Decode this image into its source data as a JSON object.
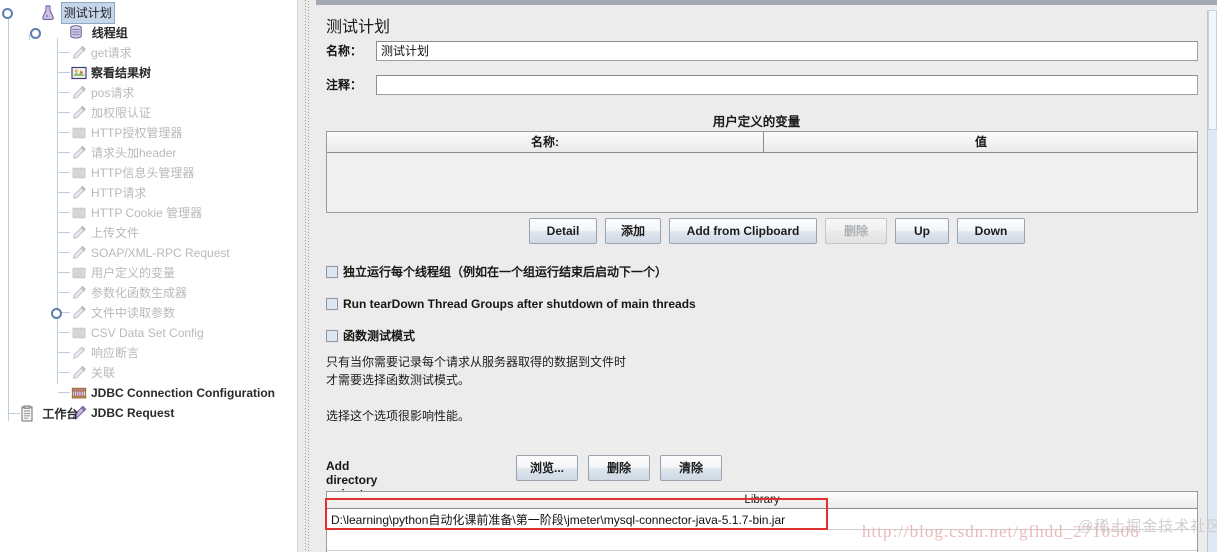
{
  "tree": {
    "root": {
      "label": "测试计划",
      "icon": "flask-icon",
      "selected": true
    },
    "threadgroup": {
      "label": "线程组",
      "icon": "thread-group-icon"
    },
    "items": [
      {
        "label": "get请求",
        "icon": "sampler-pencil-icon",
        "state": "dim"
      },
      {
        "label": "察看结果树",
        "icon": "view-results-tree-icon",
        "state": "solid"
      },
      {
        "label": "pos请求",
        "icon": "sampler-pencil-icon",
        "state": "dim"
      },
      {
        "label": "加权限认证",
        "icon": "sampler-pencil-icon",
        "state": "dim"
      },
      {
        "label": "HTTP授权管理器",
        "icon": "config-gear-icon",
        "state": "dim"
      },
      {
        "label": "请求头加header",
        "icon": "sampler-pencil-icon",
        "state": "dim"
      },
      {
        "label": "HTTP信息头管理器",
        "icon": "config-gear-icon",
        "state": "dim"
      },
      {
        "label": "HTTP请求",
        "icon": "sampler-pencil-icon",
        "state": "dim"
      },
      {
        "label": "HTTP Cookie 管理器",
        "icon": "config-gear-icon",
        "state": "dim"
      },
      {
        "label": "上传文件",
        "icon": "sampler-pencil-icon",
        "state": "dim"
      },
      {
        "label": "SOAP/XML-RPC Request",
        "icon": "sampler-pencil-icon",
        "state": "dim"
      },
      {
        "label": "用户定义的变量",
        "icon": "config-gear-icon",
        "state": "dim"
      },
      {
        "label": "参数化函数生成器",
        "icon": "sampler-pencil-icon",
        "state": "dim"
      },
      {
        "label": "文件中读取参数",
        "icon": "sampler-pencil-icon",
        "state": "dim",
        "handle": true
      },
      {
        "label": "CSV Data Set Config",
        "icon": "config-gear-icon",
        "state": "dim"
      },
      {
        "label": "响应断言",
        "icon": "assertion-icon",
        "state": "dim"
      },
      {
        "label": "关联",
        "icon": "sampler-pencil-icon",
        "state": "dim"
      },
      {
        "label": "JDBC Connection Configuration",
        "icon": "jdbc-config-icon",
        "state": "solid"
      },
      {
        "label": "JDBC Request",
        "icon": "jdbc-request-icon",
        "state": "solid"
      }
    ],
    "workbench": {
      "label": "工作台",
      "icon": "workbench-icon"
    }
  },
  "panel": {
    "title": "测试计划",
    "name_label": "名称：",
    "name_value": "测试计划",
    "comment_label": "注释：",
    "comment_value": "",
    "udv_title": "用户定义的变量",
    "udv_columns": [
      "名称:",
      "值"
    ],
    "udv_rows": [],
    "buttons": [
      {
        "label": "Detail",
        "enabled": true
      },
      {
        "label": "添加",
        "enabled": true
      },
      {
        "label": "Add from Clipboard",
        "enabled": true
      },
      {
        "label": "删除",
        "enabled": false
      },
      {
        "label": "Up",
        "enabled": true
      },
      {
        "label": "Down",
        "enabled": true
      }
    ],
    "checkboxes": [
      {
        "label": "独立运行每个线程组（例如在一个组运行结束后启动下一个）",
        "checked": false
      },
      {
        "label": "Run tearDown Thread Groups after shutdown of main threads",
        "checked": false
      },
      {
        "label": "函数测试模式",
        "checked": false
      }
    ],
    "notes": [
      "只有当你需要记录每个请求从服务器取得的数据到文件时",
      "才需要选择函数测试模式。",
      "选择这个选项很影响性能。"
    ],
    "classpath_label": "Add directory or jar to classpath",
    "classpath_buttons": [
      {
        "label": "浏览...",
        "enabled": true
      },
      {
        "label": "删除",
        "enabled": true
      },
      {
        "label": "清除",
        "enabled": true
      }
    ],
    "library_header": "Library",
    "library_rows": [
      "D:\\learning\\python自动化课前准备\\第一阶段\\jmeter\\mysql-connector-java-5.1.7-bin.jar"
    ]
  },
  "annotations": {
    "highlight_color": "#e03030"
  },
  "watermarks": {
    "csdn": "http://blog.csdn.net/gfhdd_2710506",
    "juejin": "@稀土掘金技术社区"
  }
}
